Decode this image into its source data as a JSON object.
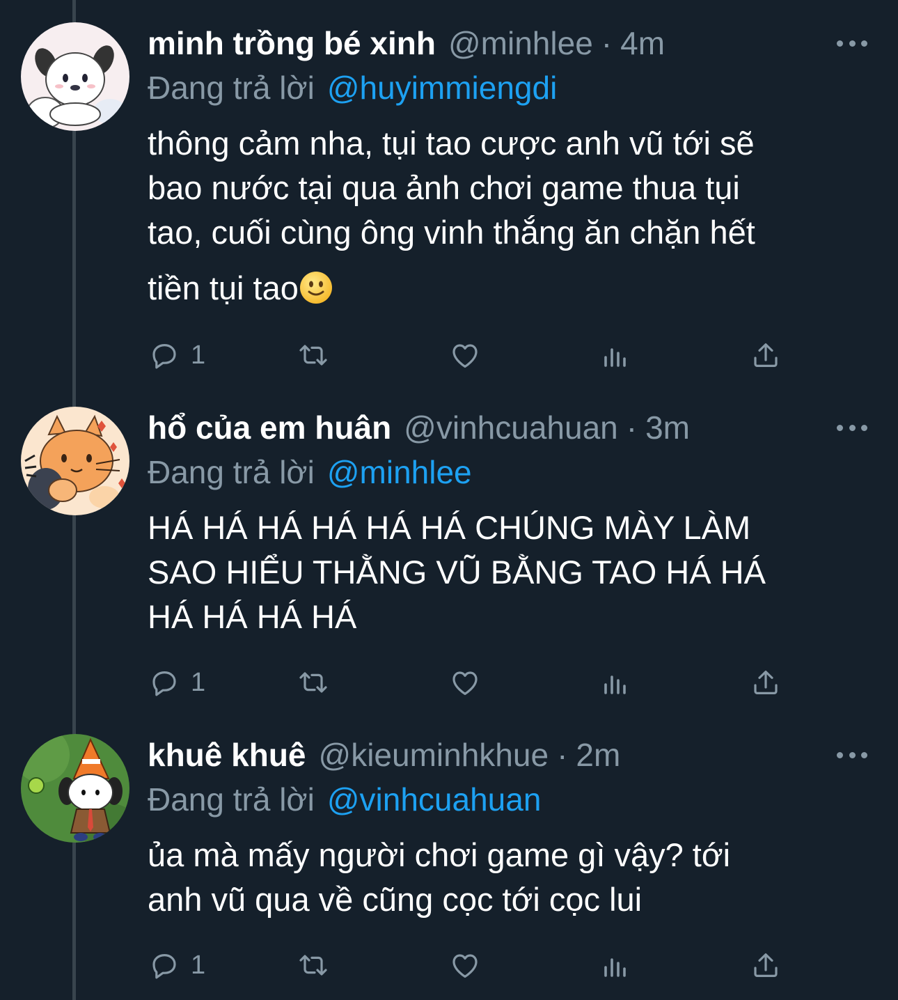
{
  "tweets": [
    {
      "display_name": "minh trồng bé xinh",
      "handle": "@minhlee",
      "separator": "·",
      "time": "4m",
      "reply_label": "Đang trả lời",
      "reply_to": "@huyimmiengdi",
      "lines": [
        "thông cảm nha, tụi tao cược anh vũ tới sẽ",
        "bao nước tại qua ảnh chơi game thua tụi",
        "tao, cuối cùng ông vinh thắng ăn chặn hết",
        "tiền tụi tao"
      ],
      "trailing_emoji": "slightly-smiling-face",
      "reply_count": "1",
      "avatar": "white-puppy-avatar"
    },
    {
      "display_name": "hổ của em huân",
      "handle": "@vinhcuahuan",
      "separator": "·",
      "time": "3m",
      "reply_label": "Đang trả lời",
      "reply_to": "@minhlee",
      "lines": [
        "HÁ HÁ HÁ HÁ HÁ HÁ CHÚNG MÀY LÀM",
        "SAO HIỂU THẰNG VŨ BẰNG TAO HÁ HÁ",
        "HÁ HÁ HÁ HÁ"
      ],
      "reply_count": "1",
      "avatar": "orange-cat-avatar"
    },
    {
      "display_name": "khuê khuê",
      "handle": "@kieuminhkhue",
      "separator": "·",
      "time": "2m",
      "reply_label": "Đang trả lời",
      "reply_to": "@vinhcuahuan",
      "lines": [
        "ủa mà mấy người chơi game gì vậy? tới",
        "anh vũ qua về cũng cọc tới cọc lui"
      ],
      "reply_count": "1",
      "avatar": "puppy-traffic-cone-avatar"
    }
  ],
  "colors": {
    "background": "#15202b",
    "text_primary": "#ffffff",
    "text_secondary": "#8899a6",
    "accent": "#1da1f2",
    "thread_line": "#38444d"
  },
  "icons": [
    "reply-icon",
    "retweet-icon",
    "like-icon",
    "analytics-icon",
    "share-icon",
    "more-icon"
  ]
}
